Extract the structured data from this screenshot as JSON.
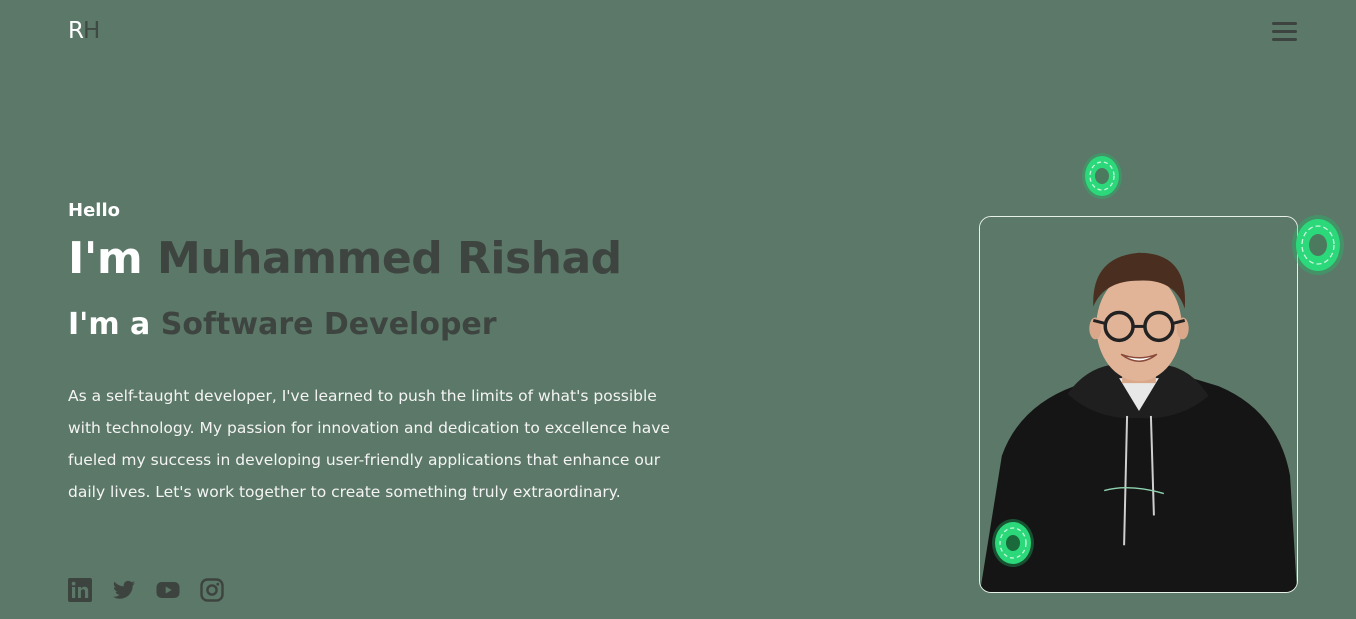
{
  "header": {
    "logo_first": "R",
    "logo_second": "H"
  },
  "hero": {
    "greeting": "Hello",
    "name_prefix": "I'm",
    "name": "Muhammed Rishad",
    "role_prefix": "I'm a",
    "role": "Software Developer",
    "bio": "As a self-taught developer, I've learned to push the limits of what's possible with technology. My passion for innovation and dedication to excellence have fueled my success in developing user-friendly applications that enhance our daily lives. Let's work together to create something truly extraordinary."
  },
  "socials": [
    {
      "name": "linkedin",
      "icon": "linkedin-icon"
    },
    {
      "name": "twitter",
      "icon": "twitter-icon"
    },
    {
      "name": "youtube",
      "icon": "youtube-icon"
    },
    {
      "name": "instagram",
      "icon": "instagram-icon"
    }
  ],
  "colors": {
    "background": "#5b7868",
    "accent_dark": "#3e4541",
    "text_light": "#ffffff",
    "glow_green": "#2ee37a"
  }
}
